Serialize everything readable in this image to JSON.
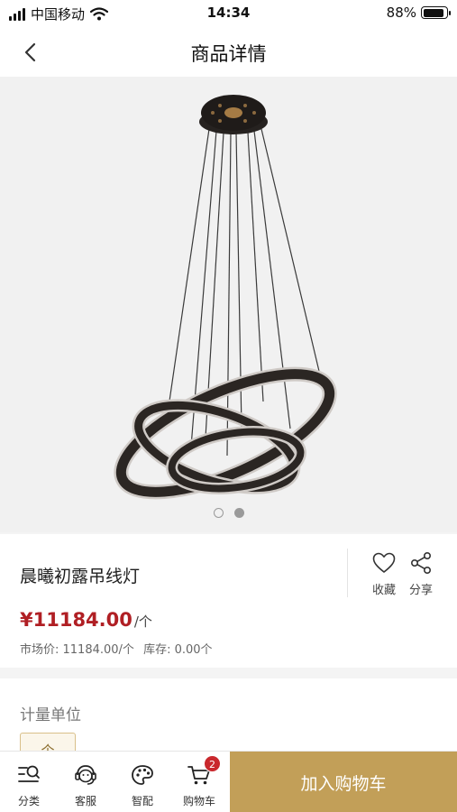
{
  "status_bar": {
    "carrier": "中国移动",
    "time": "14:34",
    "battery_percent": "88%",
    "battery_level": 0.88
  },
  "nav": {
    "title": "商品详情",
    "back_icon": "chevron-left-icon"
  },
  "gallery": {
    "image_count": 2,
    "active_index": 1
  },
  "product": {
    "name": "晨曦初露吊线灯",
    "price": "¥11184.00",
    "price_unit": "/个",
    "market_price_label": "市场价: 11184.00/个",
    "stock_label": "库存: 0.00个"
  },
  "actions": {
    "favorite": {
      "label": "收藏",
      "icon": "heart-icon"
    },
    "share": {
      "label": "分享",
      "icon": "share-icon"
    }
  },
  "spec": {
    "title": "计量单位",
    "options": [
      "个"
    ]
  },
  "bottom_bar": {
    "tabs": [
      {
        "label": "分类",
        "icon": "category-search-icon"
      },
      {
        "label": "客服",
        "icon": "customer-service-icon"
      },
      {
        "label": "智配",
        "icon": "palette-icon"
      },
      {
        "label": "购物车",
        "icon": "cart-icon",
        "badge": "2"
      }
    ],
    "add_to_cart_label": "加入购物车"
  },
  "colors": {
    "accent_gold": "#c29f58",
    "price_red": "#b01f24",
    "badge_red": "#c9282d"
  }
}
